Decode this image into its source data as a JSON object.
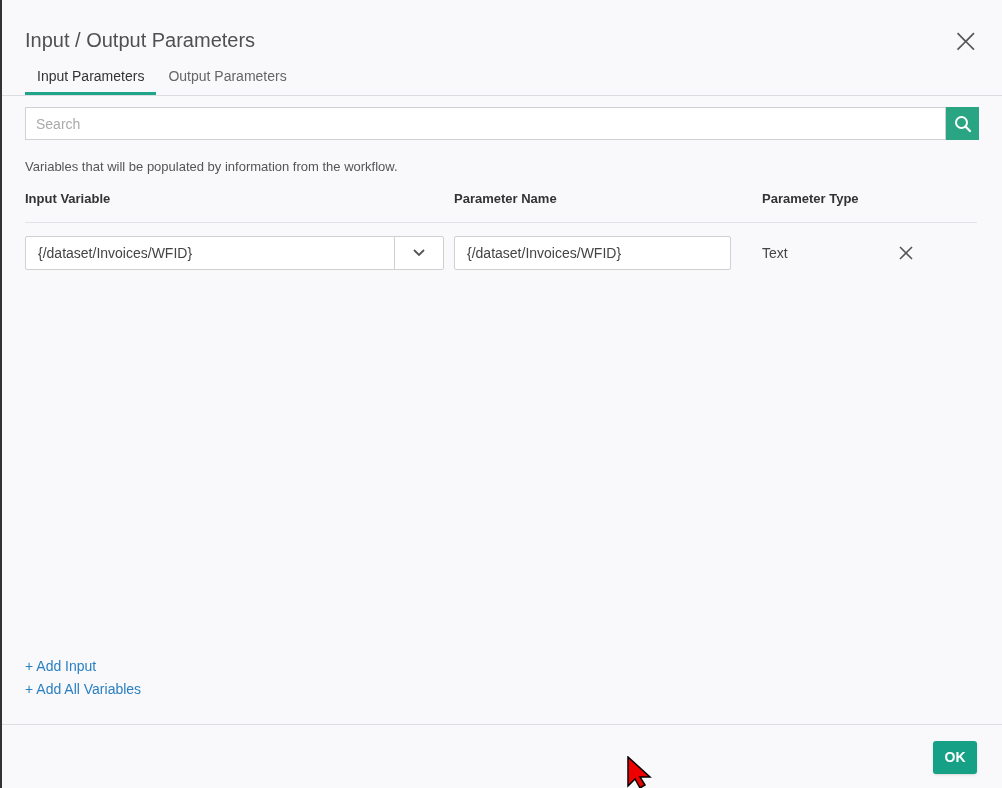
{
  "dialog": {
    "title": "Input / Output Parameters",
    "close": "×"
  },
  "tabs": [
    {
      "label": "Input Parameters",
      "selected": true
    },
    {
      "label": "Output Parameters",
      "selected": false
    }
  ],
  "search": {
    "placeholder": "Search"
  },
  "description": "Variables that will be populated by information from the workflow.",
  "table": {
    "columns": [
      "Input Variable",
      "Parameter Name",
      "Parameter Type"
    ],
    "rows": [
      {
        "input_variable": "{/dataset/Invoices/WFID}",
        "parameter_name": "{/dataset/Invoices/WFID}",
        "parameter_type": "Text"
      }
    ]
  },
  "links": [
    "+ Add Input",
    "+ Add All Variables"
  ],
  "footer": {
    "ok": "OK"
  }
}
